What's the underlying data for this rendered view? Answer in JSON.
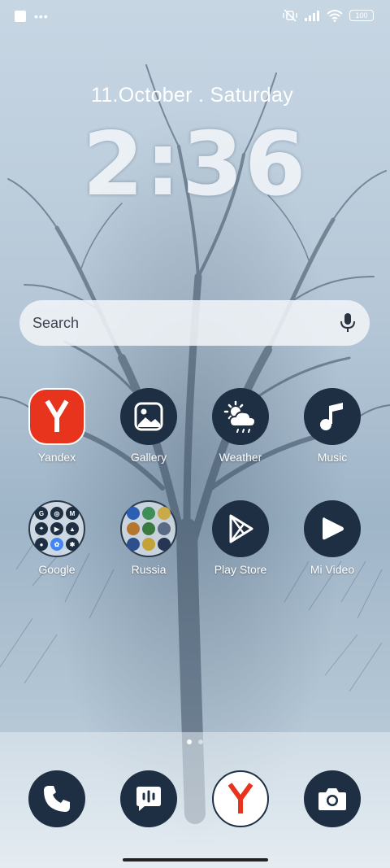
{
  "status_bar": {
    "battery": "100",
    "icons": [
      "notification-square-icon",
      "more-dots-icon",
      "vibrate-off-icon",
      "signal-icon",
      "wifi-icon",
      "battery-icon"
    ]
  },
  "lockscreen": {
    "date": "11.October . Saturday",
    "time": "2:36"
  },
  "search": {
    "placeholder": "Search",
    "mic_icon": "microphone-icon"
  },
  "apps": [
    {
      "label": "Yandex",
      "icon": "yandex-browser-icon"
    },
    {
      "label": "Gallery",
      "icon": "gallery-icon"
    },
    {
      "label": "Weather",
      "icon": "weather-icon"
    },
    {
      "label": "Music",
      "icon": "music-icon"
    },
    {
      "label": "Google",
      "icon": "folder-icon"
    },
    {
      "label": "Russia",
      "icon": "folder-icon"
    },
    {
      "label": "Play Store",
      "icon": "play-store-icon"
    },
    {
      "label": "Mi Video",
      "icon": "mi-video-icon"
    }
  ],
  "page_indicator": {
    "pages": 2,
    "current": 1
  },
  "dock": [
    "phone-icon",
    "messages-icon",
    "yandex-icon",
    "camera-icon"
  ],
  "colors": {
    "icon_bg": "#1e2f44",
    "yandex_red": "#e8341c",
    "label": "#ffffff"
  }
}
